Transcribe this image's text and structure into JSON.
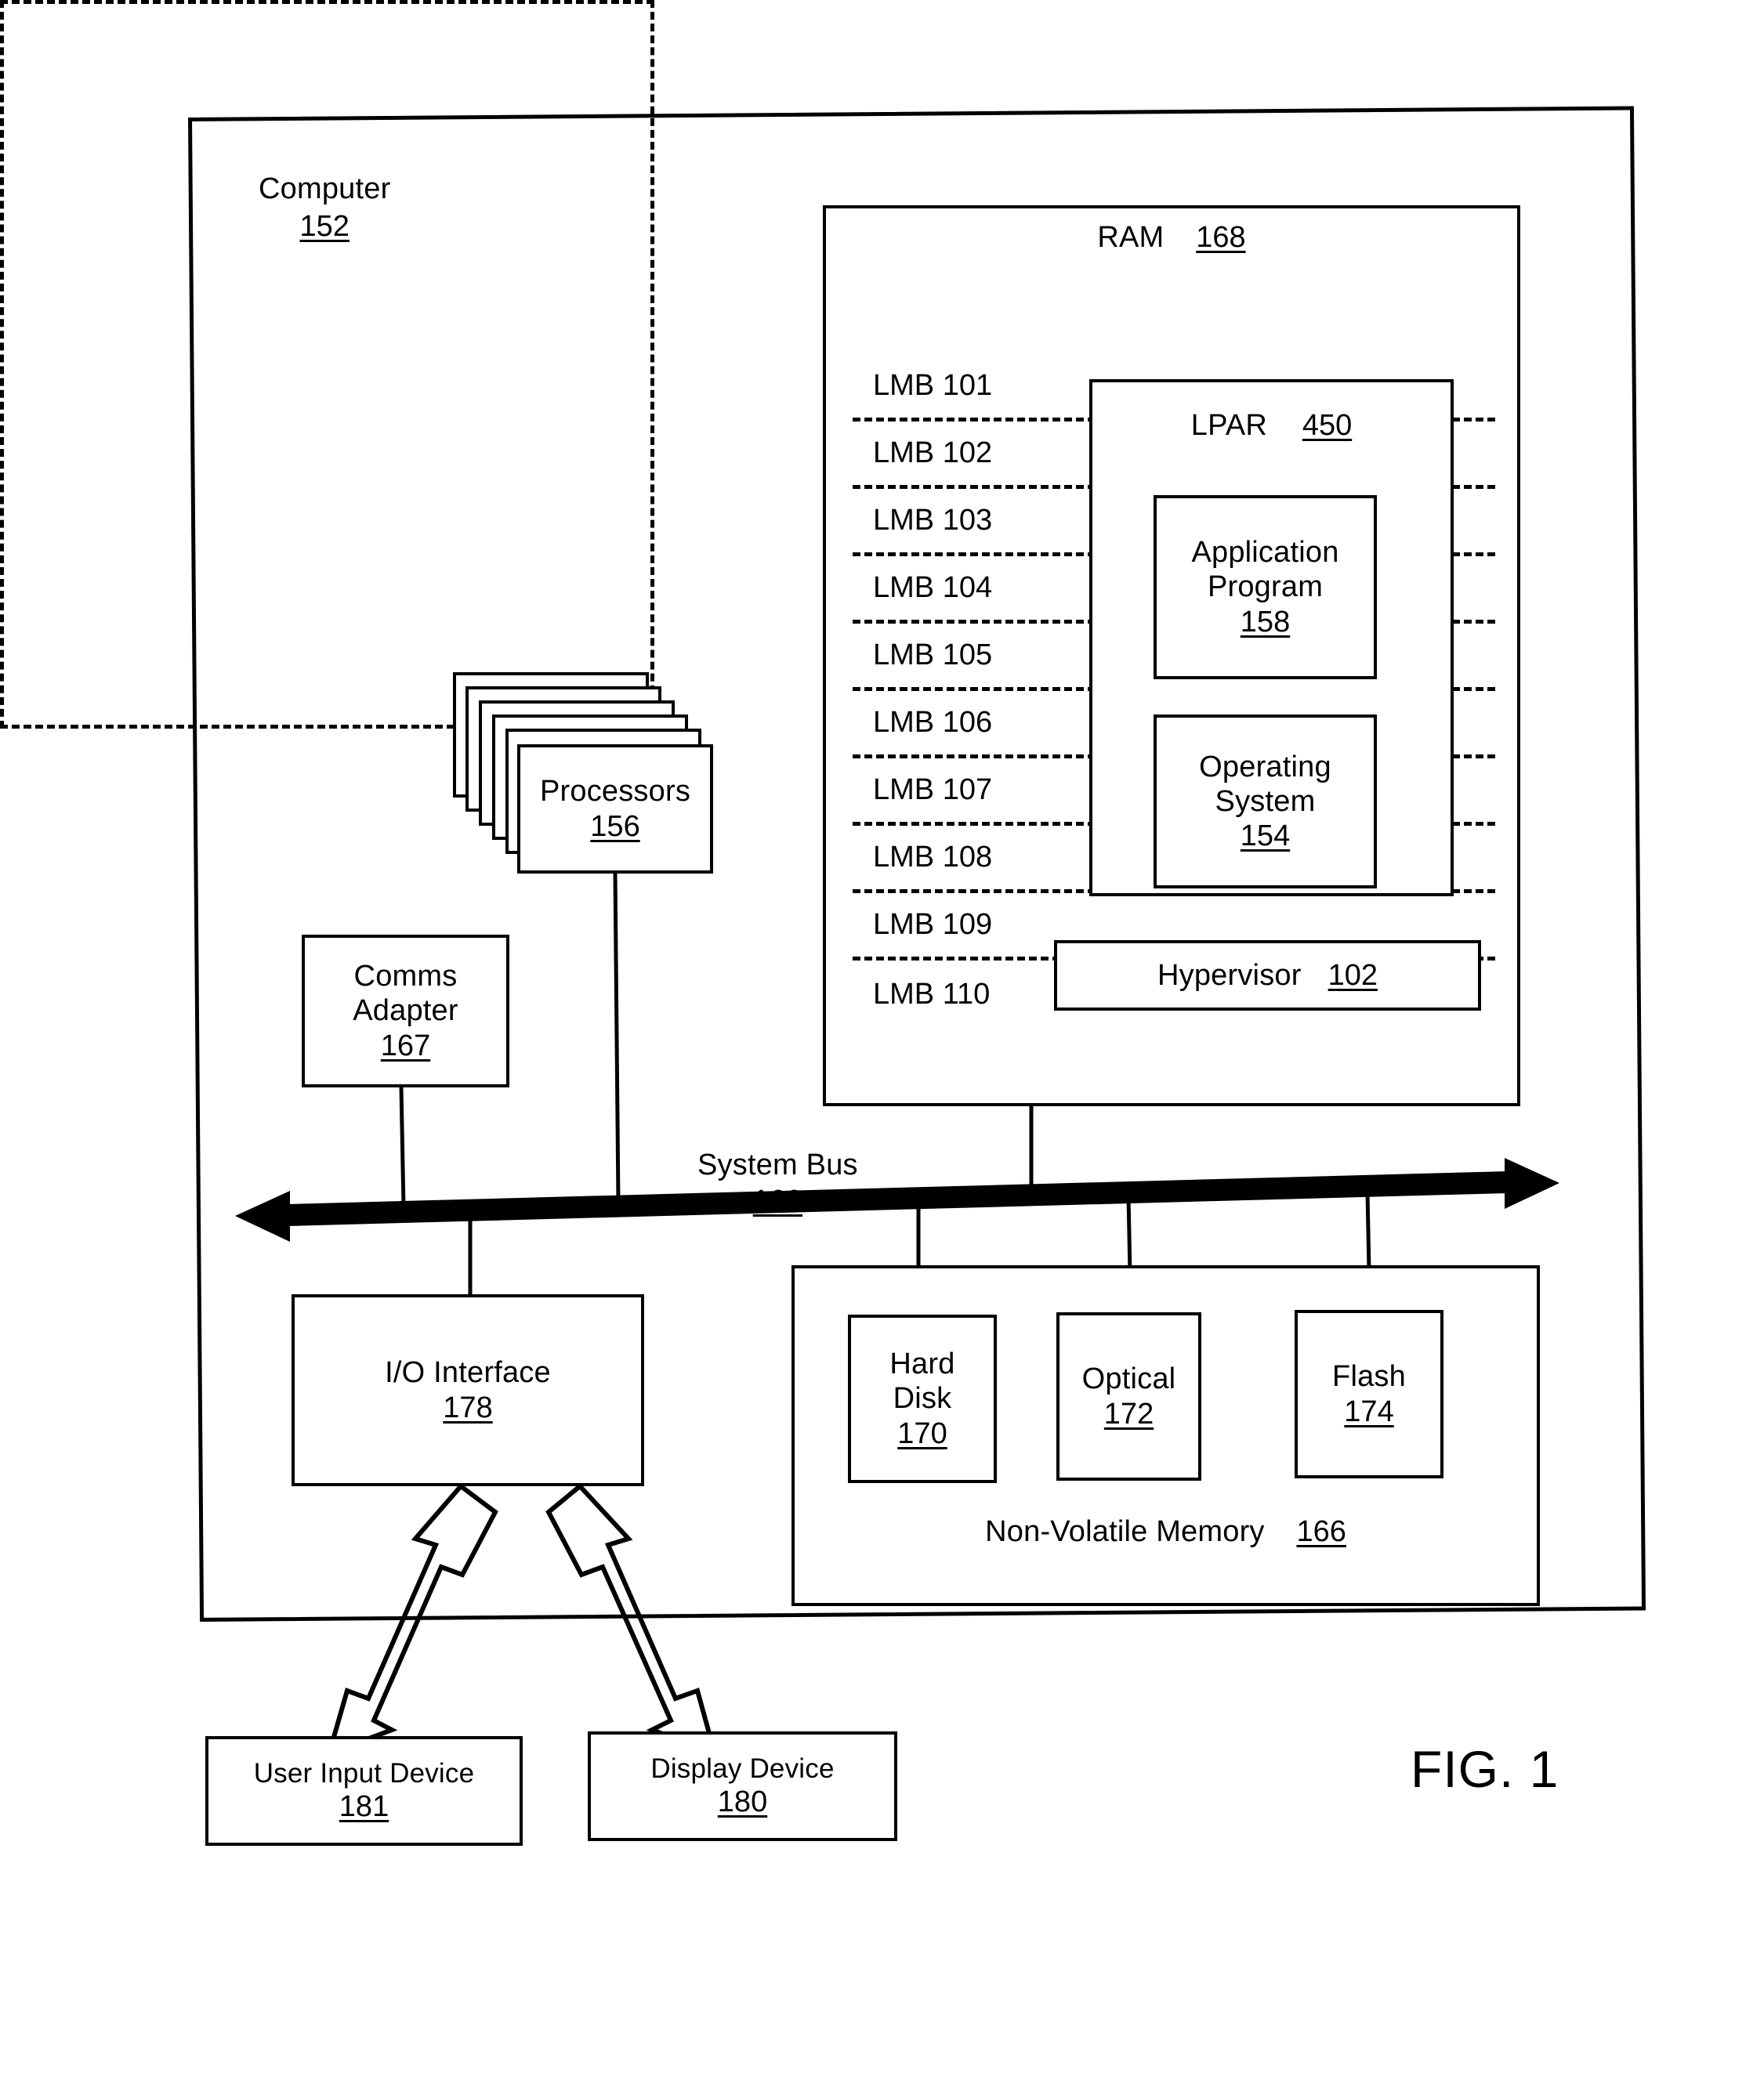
{
  "figure": {
    "caption": "FIG. 1"
  },
  "computer": {
    "label": "Computer",
    "ref": "152"
  },
  "ram": {
    "label": "RAM",
    "ref": "168",
    "lmbs": [
      "LMB 101",
      "LMB 102",
      "LMB 103",
      "LMB 104",
      "LMB 105",
      "LMB 106",
      "LMB 107",
      "LMB 108",
      "LMB 109",
      "LMB 110"
    ]
  },
  "lpar": {
    "label": "LPAR",
    "ref": "450",
    "application_program": {
      "line1": "Application",
      "line2": "Program",
      "ref": "158"
    },
    "operating_system": {
      "line1": "Operating",
      "line2": "System",
      "ref": "154"
    }
  },
  "hypervisor": {
    "label": "Hypervisor",
    "ref": "102"
  },
  "processors": {
    "label": "Processors",
    "ref": "156"
  },
  "comms_adapter": {
    "line1": "Comms",
    "line2": "Adapter",
    "ref": "167"
  },
  "system_bus": {
    "label": "System Bus",
    "ref": "160"
  },
  "io_interface": {
    "label": "I/O Interface",
    "ref": "178"
  },
  "non_volatile_memory": {
    "label": "Non-Volatile Memory",
    "ref": "166",
    "hard_disk": {
      "line1": "Hard",
      "line2": "Disk",
      "ref": "170"
    },
    "optical": {
      "label": "Optical",
      "ref": "172"
    },
    "flash": {
      "label": "Flash",
      "ref": "174"
    }
  },
  "user_input_device": {
    "label": "User Input Device",
    "ref": "181"
  },
  "display_device": {
    "label": "Display Device",
    "ref": "180"
  },
  "colors": {
    "ink": "#000000",
    "paper": "#ffffff"
  }
}
